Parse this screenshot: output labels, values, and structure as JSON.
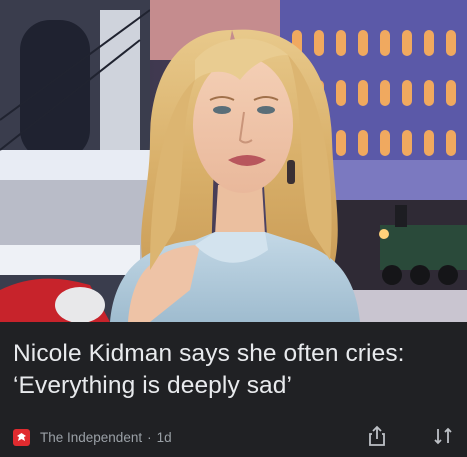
{
  "article": {
    "image_alt": "Woman with long blonde wavy hair in a light blue top, smiling, in front of a festive window display",
    "headline": "Nicole Kidman says she often cries: ‘Everything is deeply sad’",
    "source": "The Independent",
    "separator": "·",
    "age": "1d"
  },
  "icons": {
    "source_logo": "independent-eagle-icon",
    "share": "share-icon",
    "more": "feedback-sort-icon"
  },
  "colors": {
    "card_background": "#202124",
    "headline_text": "#e8eaed",
    "meta_text": "#9aa0a6",
    "source_logo_red": "#e02b2f"
  }
}
